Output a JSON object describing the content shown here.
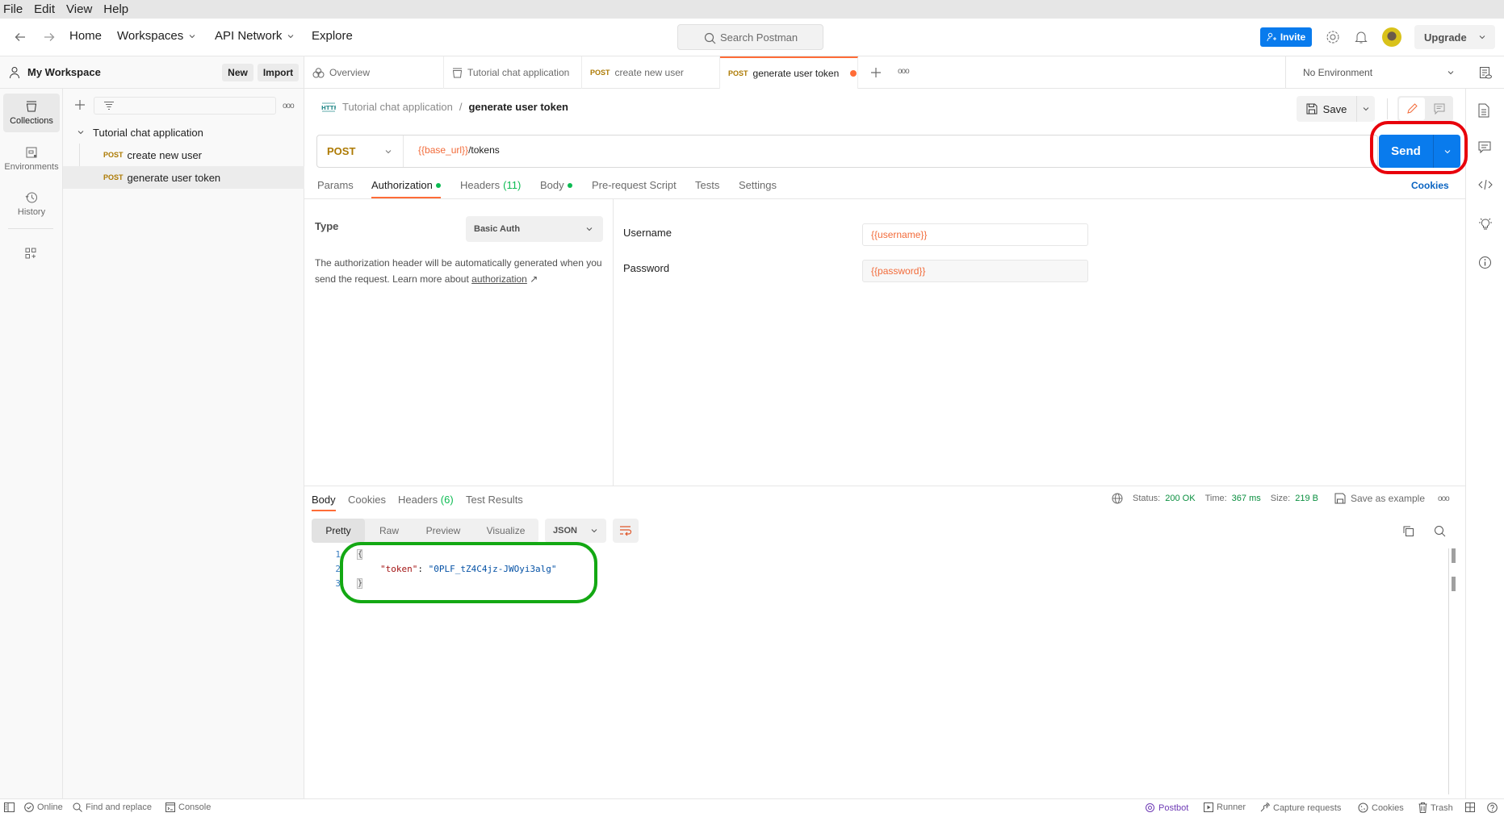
{
  "menu": [
    "File",
    "Edit",
    "View",
    "Help"
  ],
  "topnav": {
    "home": "Home",
    "workspaces": "Workspaces",
    "api_network": "API Network",
    "explore": "Explore",
    "search_placeholder": "Search Postman",
    "invite": "Invite",
    "upgrade": "Upgrade"
  },
  "workspace": {
    "name": "My Workspace",
    "new": "New",
    "import": "Import"
  },
  "sidebar": {
    "items": [
      {
        "label": "Collections",
        "icon": "collections-icon",
        "active": true
      },
      {
        "label": "Environments",
        "icon": "environments-icon",
        "active": false
      },
      {
        "label": "History",
        "icon": "history-icon",
        "active": false
      }
    ]
  },
  "collections": {
    "tree": [
      {
        "label": "Tutorial chat application",
        "type": "collection"
      },
      {
        "method": "POST",
        "label": "create new user"
      },
      {
        "method": "POST",
        "label": "generate user token",
        "selected": true
      }
    ]
  },
  "tabs": [
    {
      "label": "Overview",
      "icon": "overview-icon"
    },
    {
      "label": "Tutorial chat application",
      "icon": "collection-icon"
    },
    {
      "method": "POST",
      "label": "create new user"
    },
    {
      "method": "POST",
      "label": "generate user token",
      "active": true,
      "unsaved": true
    }
  ],
  "environment": {
    "selected": "No Environment"
  },
  "request": {
    "breadcrumb_parent": "Tutorial chat application",
    "breadcrumb_sep": "/",
    "breadcrumb_current": "generate user token",
    "save": "Save",
    "method": "POST",
    "url_var": "{{base_url}}",
    "url_path": "/tokens",
    "send": "Send",
    "cookies": "Cookies",
    "tabs": [
      {
        "label": "Params"
      },
      {
        "label": "Authorization",
        "dot": true,
        "active": true
      },
      {
        "label": "Headers",
        "count": "(11)"
      },
      {
        "label": "Body",
        "dot": true
      },
      {
        "label": "Pre-request Script"
      },
      {
        "label": "Tests"
      },
      {
        "label": "Settings"
      }
    ]
  },
  "auth": {
    "type_label": "Type",
    "type_value": "Basic Auth",
    "desc_prefix": "The authorization header will be automatically generated when you send the request. Learn more about ",
    "desc_link": "authorization",
    "desc_arrow": "↗",
    "username_label": "Username",
    "username_value": "{{username}}",
    "password_label": "Password",
    "password_value": "{{password}}"
  },
  "response": {
    "tabs": [
      {
        "label": "Body",
        "active": true
      },
      {
        "label": "Cookies"
      },
      {
        "label": "Headers",
        "count": "(6)"
      },
      {
        "label": "Test Results"
      }
    ],
    "status_label": "Status:",
    "status_value": "200 OK",
    "time_label": "Time:",
    "time_value": "367 ms",
    "size_label": "Size:",
    "size_value": "219 B",
    "save_example": "Save as example",
    "views": [
      "Pretty",
      "Raw",
      "Preview",
      "Visualize"
    ],
    "active_view": "Pretty",
    "format": "JSON",
    "code": {
      "lines": [
        "1",
        "2",
        "3"
      ],
      "open": "{",
      "key": "\"token\"",
      "colon": ": ",
      "value": "\"0PLF_tZ4C4jz-JWOyi3alg\"",
      "close": "}"
    }
  },
  "statusbar": {
    "online": "Online",
    "find_replace": "Find and replace",
    "console": "Console",
    "postbot": "Postbot",
    "runner": "Runner",
    "capture": "Capture requests",
    "cookies": "Cookies",
    "trash": "Trash"
  },
  "colors": {
    "accent": "#ff6c37",
    "primary_blue": "#097bed",
    "post_method": "#ad7a03",
    "success_green": "#0a8f3f",
    "annotation_red": "#e8000b",
    "annotation_green": "#13a813"
  }
}
